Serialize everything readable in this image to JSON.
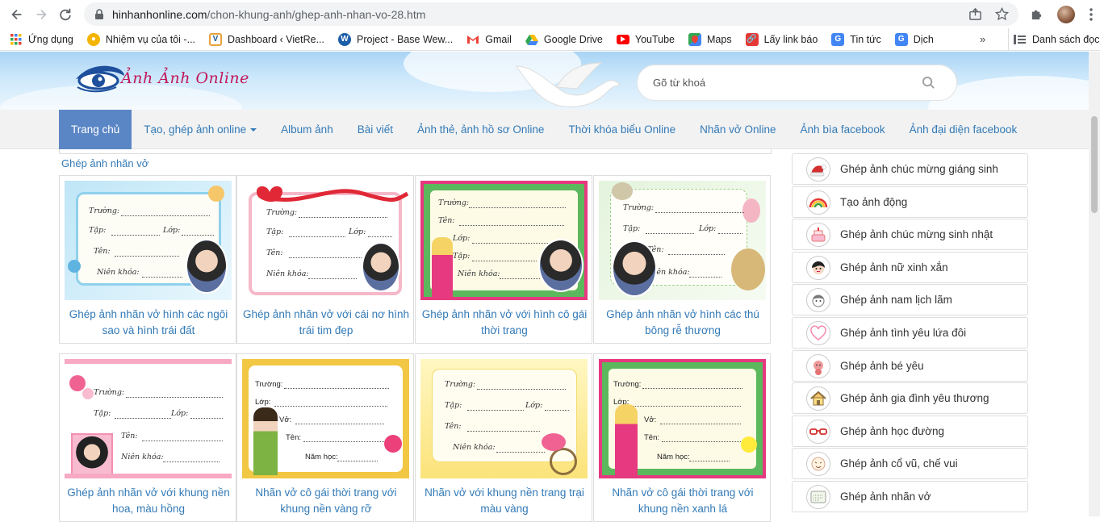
{
  "browser": {
    "url_host": "hinhanhonline.com",
    "url_path": "/chon-khung-anh/ghep-anh-nhan-vo-28.htm",
    "bookmarks": [
      {
        "label": "Ứng dụng",
        "icon": "apps-grid-icon"
      },
      {
        "label": "Nhiệm vụ của tôi -...",
        "icon": "task-icon"
      },
      {
        "label": "Dashboard ‹ VietRe...",
        "icon": "dashboard-icon"
      },
      {
        "label": "Project - Base Wew...",
        "icon": "wordpress-icon"
      },
      {
        "label": "Gmail",
        "icon": "gmail-icon"
      },
      {
        "label": "Google Drive",
        "icon": "google-drive-icon"
      },
      {
        "label": "YouTube",
        "icon": "youtube-icon"
      },
      {
        "label": "Maps",
        "icon": "maps-icon"
      },
      {
        "label": "Lấy link báo",
        "icon": "link-icon"
      },
      {
        "label": "Tin tức",
        "icon": "news-icon"
      },
      {
        "label": "Dịch",
        "icon": "translate-icon"
      }
    ],
    "more": "»",
    "reading_list": "Danh sách đọc"
  },
  "site": {
    "logo_text": "Ảnh Ảnh Online",
    "search_placeholder": "Gõ từ khoá",
    "menu": [
      {
        "label": "Trang chủ",
        "active": true
      },
      {
        "label": "Tạo, ghép ảnh online",
        "dropdown": true
      },
      {
        "label": "Album ảnh"
      },
      {
        "label": "Bài viết"
      },
      {
        "label": "Ảnh thẻ, ảnh hồ sơ Online"
      },
      {
        "label": "Thời khóa biểu Online"
      },
      {
        "label": "Nhãn vở Online"
      },
      {
        "label": "Ảnh bìa facebook"
      },
      {
        "label": "Ảnh đại diện facebook"
      }
    ]
  },
  "main": {
    "section_title": "Ghép ảnh nhãn vở",
    "cards": [
      {
        "title": "Ghép ảnh nhãn vở hình các ngôi sao và hình trái đất",
        "labels": [
          "Trường:",
          "Tập:",
          "Lớp:",
          "Tên:",
          "Niên khóa:"
        ]
      },
      {
        "title": "Ghép ảnh nhãn vở với cái nơ hình trái tim đẹp",
        "labels": [
          "Trường:",
          "Tập:",
          "Lớp:",
          "Tên:",
          "Niên khóa:"
        ]
      },
      {
        "title": "Ghép ảnh nhãn vở với hình cô gái thời trang",
        "labels": [
          "Trường:",
          "Tên:",
          "Lớp:",
          "Tập:",
          "Niên khóa:"
        ]
      },
      {
        "title": "Ghép ảnh nhãn vở hình các thú bông rễ thương",
        "labels": [
          "Trường:",
          "Tập:",
          "Lớp:",
          "Tên:",
          "Niên khóa:"
        ]
      },
      {
        "title": "Ghép ảnh nhãn vở với khung nền hoa, màu hồng",
        "labels": [
          "Trường:",
          "Tập:",
          "Lớp:",
          "Tên:",
          "Niên khóa:"
        ]
      },
      {
        "title": "Nhãn vở cô gái thời trang với khung nền vàng rỡ",
        "labels": [
          "Trường:",
          "Lớp:",
          "Vở:",
          "Tên:",
          "Năm học:"
        ]
      },
      {
        "title": "Nhãn vở với khung nền trang trại màu vàng",
        "labels": [
          "Trường:",
          "Tập:",
          "Lớp:",
          "Tên:",
          "Niên khóa:"
        ]
      },
      {
        "title": "Nhãn vở cô gái thời trang với khung nền xanh lá",
        "labels": [
          "Trường:",
          "Lớp:",
          "Vở:",
          "Tên:",
          "Năm học:"
        ]
      }
    ]
  },
  "sidebar": {
    "items": [
      {
        "label": "Ghép ảnh chúc mừng giáng sinh",
        "icon": "santa-hat-icon"
      },
      {
        "label": "Tạo ảnh động",
        "icon": "rainbow-icon"
      },
      {
        "label": "Ghép ảnh chúc mừng sinh nhật",
        "icon": "birthday-cake-icon"
      },
      {
        "label": "Ghép ảnh nữ xinh xắn",
        "icon": "girl-face-icon"
      },
      {
        "label": "Ghép ảnh nam lịch lãm",
        "icon": "boy-face-icon"
      },
      {
        "label": "Ghép ảnh tình yêu lứa đôi",
        "icon": "heart-icon"
      },
      {
        "label": "Ghép ảnh bé yêu",
        "icon": "baby-icon"
      },
      {
        "label": "Ghép ảnh gia đình yêu thương",
        "icon": "house-icon"
      },
      {
        "label": "Ghép ảnh học đường",
        "icon": "glasses-icon"
      },
      {
        "label": "Ghép ảnh cổ vũ, chế vui",
        "icon": "funny-face-icon"
      },
      {
        "label": "Ghép ảnh nhãn vở",
        "icon": "notebook-label-icon"
      }
    ]
  },
  "colors": {
    "link": "#337ab7",
    "active_menu": "#5b86c5",
    "banner_sky": "#a9d4f5"
  }
}
